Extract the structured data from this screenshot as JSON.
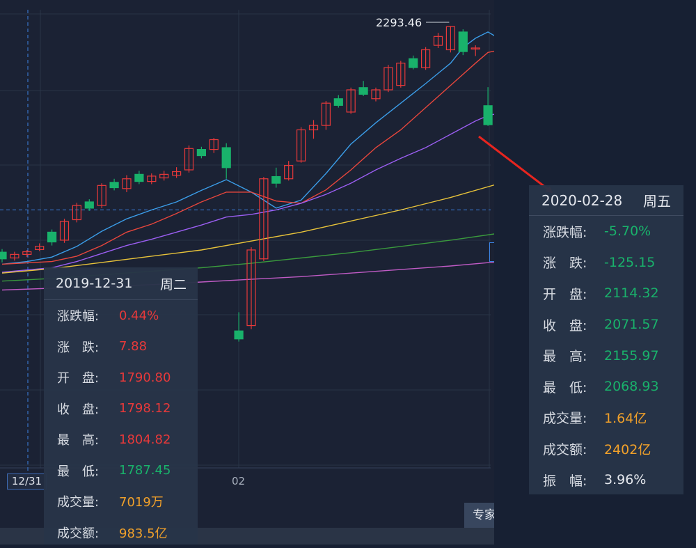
{
  "chart_data": {
    "type": "candlestick",
    "title": "",
    "x_tick_labels": [
      "02"
    ],
    "crosshair_date_label": "12/31",
    "max_annotation": "2293.46",
    "ylim": [
      1300,
      2330
    ],
    "candles": [
      {
        "o": 1785,
        "c": 1770,
        "h": 1792,
        "l": 1762
      },
      {
        "o": 1772,
        "c": 1780,
        "h": 1786,
        "l": 1766
      },
      {
        "o": 1780,
        "c": 1786,
        "h": 1790,
        "l": 1774
      },
      {
        "o": 1790.8,
        "c": 1798.12,
        "h": 1804.82,
        "l": 1787.45
      },
      {
        "o": 1830,
        "c": 1808,
        "h": 1836,
        "l": 1800
      },
      {
        "o": 1812,
        "c": 1854,
        "h": 1860,
        "l": 1806
      },
      {
        "o": 1858,
        "c": 1890,
        "h": 1896,
        "l": 1852
      },
      {
        "o": 1898,
        "c": 1884,
        "h": 1904,
        "l": 1878
      },
      {
        "o": 1890,
        "c": 1935,
        "h": 1940,
        "l": 1884
      },
      {
        "o": 1942,
        "c": 1930,
        "h": 1950,
        "l": 1924
      },
      {
        "o": 1928,
        "c": 1950,
        "h": 1958,
        "l": 1920
      },
      {
        "o": 1960,
        "c": 1944,
        "h": 1968,
        "l": 1938
      },
      {
        "o": 1944,
        "c": 1956,
        "h": 1962,
        "l": 1938
      },
      {
        "o": 1952,
        "c": 1960,
        "h": 1968,
        "l": 1946
      },
      {
        "o": 1958,
        "c": 1966,
        "h": 1976,
        "l": 1952
      },
      {
        "o": 1970,
        "c": 2018,
        "h": 2025,
        "l": 1964
      },
      {
        "o": 2016,
        "c": 2002,
        "h": 2022,
        "l": 1996
      },
      {
        "o": 2016,
        "c": 2038,
        "h": 2042,
        "l": 2008
      },
      {
        "o": 2020,
        "c": 1975,
        "h": 2030,
        "l": 1950
      },
      {
        "o": 1608,
        "c": 1590,
        "h": 1650,
        "l": 1584
      },
      {
        "o": 1620,
        "c": 1790,
        "h": 1796,
        "l": 1612
      },
      {
        "o": 1770,
        "c": 1950,
        "h": 1954,
        "l": 1765
      },
      {
        "o": 1955,
        "c": 1940,
        "h": 1975,
        "l": 1930
      },
      {
        "o": 1950,
        "c": 1980,
        "h": 1990,
        "l": 1946
      },
      {
        "o": 1990,
        "c": 2060,
        "h": 2066,
        "l": 1986
      },
      {
        "o": 2060,
        "c": 2070,
        "h": 2082,
        "l": 2040
      },
      {
        "o": 2070,
        "c": 2120,
        "h": 2125,
        "l": 2060
      },
      {
        "o": 2130,
        "c": 2115,
        "h": 2138,
        "l": 2110
      },
      {
        "o": 2100,
        "c": 2150,
        "h": 2155,
        "l": 2096
      },
      {
        "o": 2155,
        "c": 2140,
        "h": 2170,
        "l": 2136
      },
      {
        "o": 2130,
        "c": 2150,
        "h": 2155,
        "l": 2124
      },
      {
        "o": 2150,
        "c": 2200,
        "h": 2206,
        "l": 2145
      },
      {
        "o": 2160,
        "c": 2210,
        "h": 2215,
        "l": 2155
      },
      {
        "o": 2220,
        "c": 2200,
        "h": 2227,
        "l": 2196
      },
      {
        "o": 2200,
        "c": 2240,
        "h": 2246,
        "l": 2195
      },
      {
        "o": 2250,
        "c": 2270,
        "h": 2278,
        "l": 2244
      },
      {
        "o": 2240,
        "c": 2292,
        "h": 2293.46,
        "l": 2234
      },
      {
        "o": 2280,
        "c": 2236,
        "h": 2286,
        "l": 2228
      },
      {
        "o": 2244,
        "c": 2244,
        "h": 2250,
        "l": 2226
      },
      {
        "o": 2114.32,
        "c": 2071.57,
        "h": 2155.97,
        "l": 2068.93
      }
    ],
    "ma_lines": [
      {
        "color": "#3b9de8",
        "points": [
          [
            0,
            1758
          ],
          [
            2,
            1764
          ],
          [
            4,
            1774
          ],
          [
            6,
            1798
          ],
          [
            8,
            1832
          ],
          [
            10,
            1860
          ],
          [
            12,
            1880
          ],
          [
            14,
            1898
          ],
          [
            16,
            1924
          ],
          [
            18,
            1948
          ],
          [
            20,
            1920
          ],
          [
            22,
            1884
          ],
          [
            24,
            1902
          ],
          [
            26,
            1962
          ],
          [
            28,
            2028
          ],
          [
            30,
            2076
          ],
          [
            32,
            2120
          ],
          [
            34,
            2164
          ],
          [
            36,
            2210
          ],
          [
            37,
            2245
          ],
          [
            38,
            2266
          ],
          [
            39,
            2280
          ],
          [
            40,
            2264
          ]
        ]
      },
      {
        "color": "#e8463c",
        "points": [
          [
            0,
            1758
          ],
          [
            4,
            1764
          ],
          [
            6,
            1776
          ],
          [
            8,
            1800
          ],
          [
            10,
            1830
          ],
          [
            12,
            1848
          ],
          [
            14,
            1872
          ],
          [
            16,
            1898
          ],
          [
            18,
            1920
          ],
          [
            20,
            1920
          ],
          [
            22,
            1900
          ],
          [
            24,
            1895
          ],
          [
            26,
            1925
          ],
          [
            28,
            1970
          ],
          [
            30,
            2020
          ],
          [
            32,
            2060
          ],
          [
            34,
            2110
          ],
          [
            36,
            2160
          ],
          [
            38,
            2210
          ],
          [
            39,
            2234
          ],
          [
            40,
            2240
          ]
        ]
      },
      {
        "color": "#9b5ef2",
        "points": [
          [
            0,
            1740
          ],
          [
            4,
            1750
          ],
          [
            6,
            1764
          ],
          [
            8,
            1782
          ],
          [
            10,
            1800
          ],
          [
            12,
            1814
          ],
          [
            14,
            1830
          ],
          [
            16,
            1846
          ],
          [
            18,
            1864
          ],
          [
            20,
            1870
          ],
          [
            22,
            1880
          ],
          [
            24,
            1895
          ],
          [
            26,
            1915
          ],
          [
            28,
            1940
          ],
          [
            30,
            1970
          ],
          [
            32,
            1996
          ],
          [
            34,
            2020
          ],
          [
            36,
            2050
          ],
          [
            38,
            2080
          ],
          [
            39,
            2092
          ],
          [
            40,
            2098
          ]
        ]
      },
      {
        "color": "#e8c33a",
        "points": [
          [
            0,
            1738
          ],
          [
            4,
            1748
          ],
          [
            8,
            1762
          ],
          [
            12,
            1776
          ],
          [
            16,
            1790
          ],
          [
            20,
            1810
          ],
          [
            24,
            1830
          ],
          [
            28,
            1855
          ],
          [
            32,
            1880
          ],
          [
            36,
            1908
          ],
          [
            40,
            1940
          ]
        ]
      },
      {
        "color": "#3a9a3d",
        "points": [
          [
            0,
            1720
          ],
          [
            4,
            1726
          ],
          [
            8,
            1734
          ],
          [
            12,
            1742
          ],
          [
            16,
            1750
          ],
          [
            20,
            1760
          ],
          [
            24,
            1772
          ],
          [
            28,
            1784
          ],
          [
            32,
            1798
          ],
          [
            36,
            1812
          ],
          [
            40,
            1828
          ]
        ]
      },
      {
        "color": "#c05bc5",
        "points": [
          [
            0,
            1700
          ],
          [
            4,
            1704
          ],
          [
            8,
            1708
          ],
          [
            12,
            1712
          ],
          [
            16,
            1718
          ],
          [
            20,
            1724
          ],
          [
            24,
            1730
          ],
          [
            28,
            1738
          ],
          [
            32,
            1746
          ],
          [
            36,
            1754
          ],
          [
            40,
            1764
          ]
        ]
      }
    ],
    "crosshair_price": 1880,
    "up_color": "#e8393a",
    "down_color": "#19b26b"
  },
  "tooltip_left": {
    "date": "2019-12-31",
    "weekday": "周二",
    "rows": [
      {
        "label": "涨跌幅:",
        "value": "0.44%",
        "color": "red"
      },
      {
        "label": "涨　跌:",
        "value": "7.88",
        "color": "red"
      },
      {
        "label": "开　盘:",
        "value": "1790.80",
        "color": "red"
      },
      {
        "label": "收　盘:",
        "value": "1798.12",
        "color": "red"
      },
      {
        "label": "最　高:",
        "value": "1804.82",
        "color": "red"
      },
      {
        "label": "最　低:",
        "value": "1787.45",
        "color": "green"
      },
      {
        "label": "成交量:",
        "value": "7019万",
        "color": "orange"
      },
      {
        "label": "成交额:",
        "value": "983.5亿",
        "color": "orange"
      }
    ]
  },
  "tooltip_right": {
    "date": "2020-02-28",
    "weekday": "周五",
    "rows": [
      {
        "label": "涨跌幅:",
        "value": "-5.70%",
        "color": "green"
      },
      {
        "label": "涨　跌:",
        "value": "-125.15",
        "color": "green"
      },
      {
        "label": "开　盘:",
        "value": "2114.32",
        "color": "green"
      },
      {
        "label": "收　盘:",
        "value": "2071.57",
        "color": "green"
      },
      {
        "label": "最　高:",
        "value": "2155.97",
        "color": "green"
      },
      {
        "label": "最　低:",
        "value": "2068.93",
        "color": "green"
      },
      {
        "label": "成交量:",
        "value": "1.64亿",
        "color": "orange"
      },
      {
        "label": "成交额:",
        "value": "2402亿",
        "color": "orange"
      },
      {
        "label": "振　幅:",
        "value": "3.96%",
        "color": "white"
      }
    ]
  },
  "toolbar": {
    "expert_label": "专家"
  },
  "colors": {
    "background": "#1b2234",
    "grid": "#2a3446",
    "arrow": "#e8251f",
    "crosshair": "#3c84e6"
  }
}
